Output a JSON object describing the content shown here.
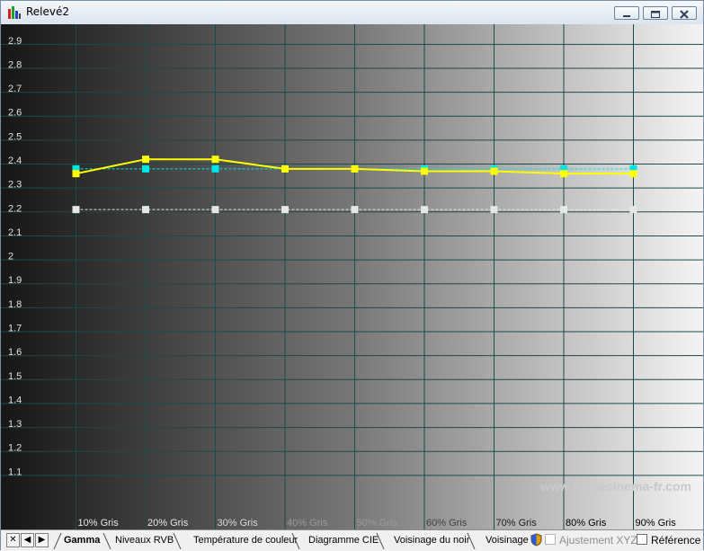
{
  "window": {
    "title": "Relevé2",
    "controls": [
      {
        "name": "minimize-button",
        "icon": "minimize-icon"
      },
      {
        "name": "maximize-button",
        "icon": "maximize-icon"
      },
      {
        "name": "close-button",
        "icon": "close-icon"
      }
    ]
  },
  "watermark": "www.homecinema-fr.com",
  "chart_data": {
    "type": "line",
    "x": [
      "10% Gris",
      "20% Gris",
      "30% Gris",
      "40% Gris",
      "50% Gris",
      "60% Gris",
      "70% Gris",
      "80% Gris",
      "90% Gris"
    ],
    "yticks": [
      "2.9",
      "2.8",
      "2.7",
      "2.6",
      "2.5",
      "2.4",
      "2.3",
      "2.2",
      "2.1",
      "2",
      "1.9",
      "1.8",
      "1.7",
      "1.6",
      "1.5",
      "1.4",
      "1.3",
      "1.2",
      "1.1"
    ],
    "ylim": [
      1.0,
      2.98
    ],
    "grid": true,
    "background": "grayscale-gradient",
    "series": [
      {
        "values": [
          2.36,
          2.42,
          2.42,
          2.38,
          2.38,
          2.37,
          2.37,
          2.36,
          2.36
        ],
        "color": "#ffff00",
        "style": "solid"
      },
      {
        "values": [
          2.38,
          2.38,
          2.38,
          2.38,
          2.38,
          2.38,
          2.38,
          2.38,
          2.38
        ],
        "color": "#00e5e5",
        "style": "dashed"
      },
      {
        "values": [
          2.21,
          2.21,
          2.21,
          2.21,
          2.21,
          2.21,
          2.21,
          2.21,
          2.21
        ],
        "color": "#e6e6e6",
        "style": "dashed"
      }
    ]
  },
  "tabs": {
    "nav": [
      "✕",
      "◀",
      "▶"
    ],
    "items": [
      {
        "label": "Gamma",
        "active": true
      },
      {
        "label": "Niveaux RVB",
        "active": false
      },
      {
        "label": "Température de couleur",
        "active": false
      },
      {
        "label": "Diagramme CIE",
        "active": false
      },
      {
        "label": "Voisinage du noir",
        "active": false
      },
      {
        "label": "Voisinage d",
        "active": false
      }
    ],
    "checkboxes": [
      {
        "label": "Ajustement XYZ",
        "checked": false,
        "disabled": true
      },
      {
        "label": "Référence",
        "checked": false,
        "disabled": false
      }
    ]
  }
}
